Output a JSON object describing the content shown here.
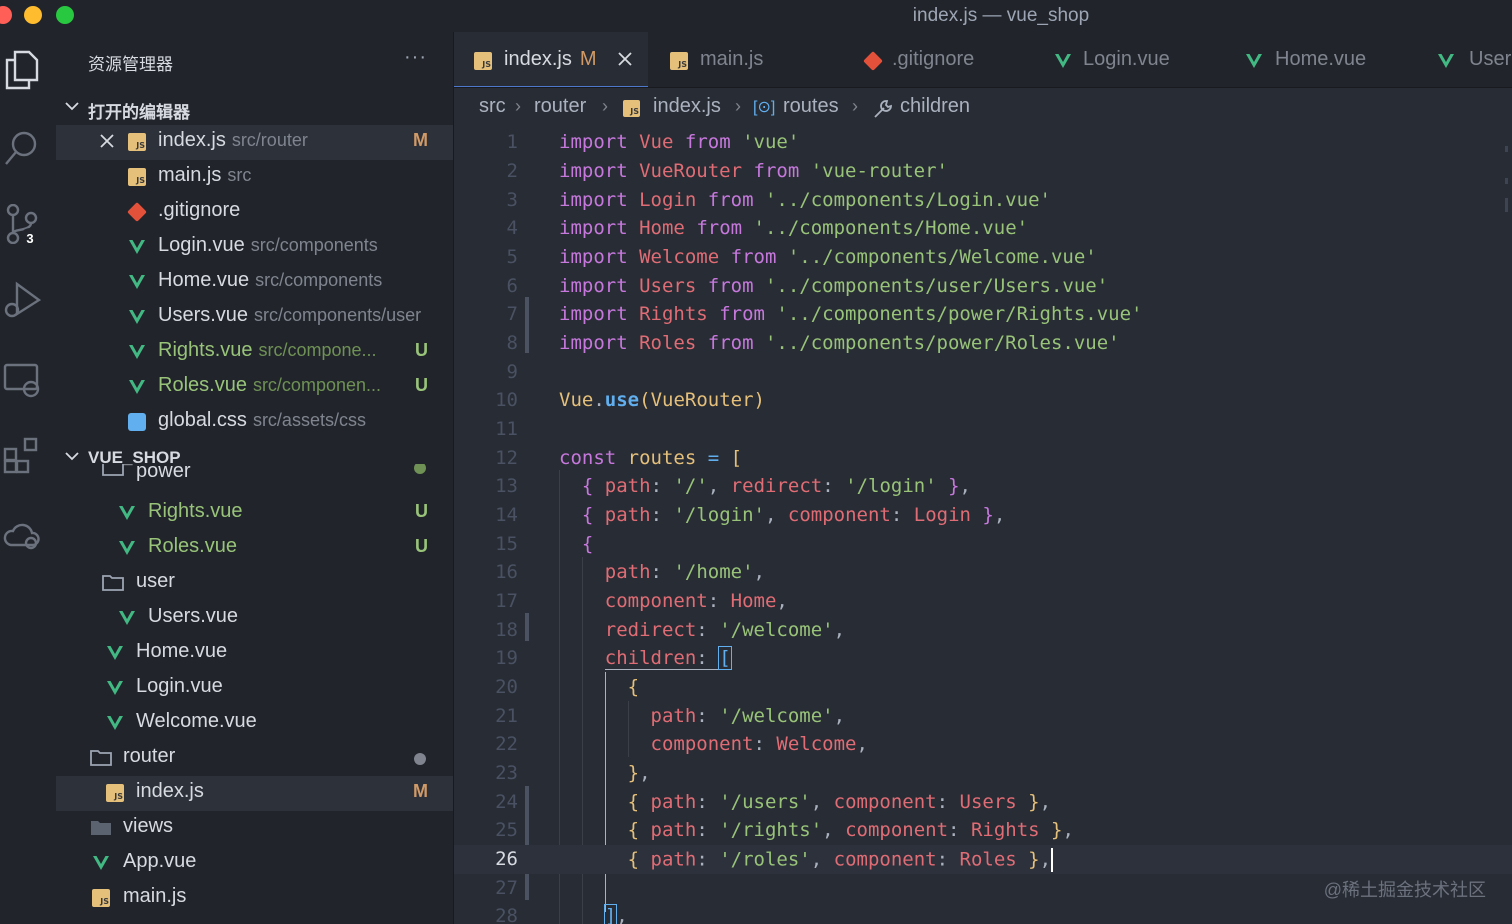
{
  "window": {
    "title": "index.js — vue_shop"
  },
  "activity": {
    "scm_badge": "3"
  },
  "sidebar": {
    "title": "资源管理器",
    "more": "···",
    "open_editors_label": "打开的编辑器",
    "workspace_label": "VUE_SHOP",
    "open_editors": [
      {
        "name": "index.js",
        "desc": "src/router",
        "status": "M"
      },
      {
        "name": "main.js",
        "desc": "src",
        "status": ""
      },
      {
        "name": ".gitignore",
        "desc": "",
        "status": ""
      },
      {
        "name": "Login.vue",
        "desc": "src/components",
        "status": ""
      },
      {
        "name": "Home.vue",
        "desc": "src/components",
        "status": ""
      },
      {
        "name": "Users.vue",
        "desc": "src/components/user",
        "status": ""
      },
      {
        "name": "Rights.vue",
        "desc": "src/compone...",
        "status": "U"
      },
      {
        "name": "Roles.vue",
        "desc": "src/componen...",
        "status": "U"
      },
      {
        "name": "global.css",
        "desc": "src/assets/css",
        "status": ""
      }
    ],
    "tree": [
      {
        "name": "power",
        "status": ""
      },
      {
        "name": "Rights.vue",
        "status": "U"
      },
      {
        "name": "Roles.vue",
        "status": "U"
      },
      {
        "name": "user",
        "status": ""
      },
      {
        "name": "Users.vue",
        "status": ""
      },
      {
        "name": "Home.vue",
        "status": ""
      },
      {
        "name": "Login.vue",
        "status": ""
      },
      {
        "name": "Welcome.vue",
        "status": ""
      },
      {
        "name": "router",
        "status": ""
      },
      {
        "name": "index.js",
        "status": "M"
      },
      {
        "name": "views",
        "status": ""
      },
      {
        "name": "App.vue",
        "status": ""
      },
      {
        "name": "main.js",
        "status": ""
      }
    ]
  },
  "tabs": [
    {
      "label": "index.js",
      "modified": "M"
    },
    {
      "label": "main.js"
    },
    {
      "label": ".gitignore"
    },
    {
      "label": "Login.vue"
    },
    {
      "label": "Home.vue"
    },
    {
      "label": "User"
    }
  ],
  "breadcrumb": [
    "src",
    "router",
    "index.js",
    "routes",
    "children"
  ],
  "editor": {
    "current_line": "26",
    "line_numbers": [
      "1",
      "2",
      "3",
      "4",
      "5",
      "6",
      "7",
      "8",
      "9",
      "10",
      "11",
      "12",
      "13",
      "14",
      "15",
      "16",
      "17",
      "18",
      "19",
      "20",
      "21",
      "22",
      "23",
      "24",
      "25",
      "26",
      "27",
      "28"
    ]
  },
  "watermark": "@稀土掘金技术社区",
  "colors": {
    "keyword": "#c678dd",
    "identifier": "#e06c75",
    "string": "#98c379",
    "function": "#61afef",
    "modified": "#d19a66",
    "untracked": "#98c379"
  }
}
